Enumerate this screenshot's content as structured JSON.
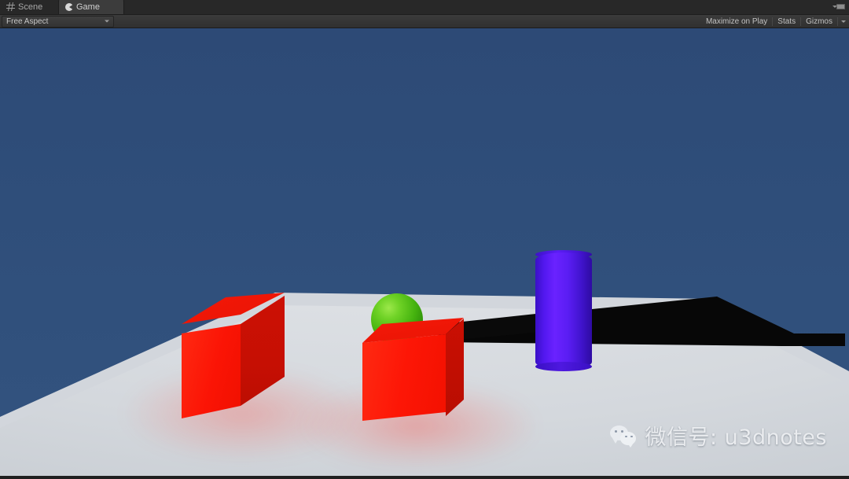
{
  "window": {
    "title": "Unity Game View"
  },
  "tabs": [
    {
      "label": "Scene",
      "icon": "grid-icon",
      "active": false
    },
    {
      "label": "Game",
      "icon": "pacman-icon",
      "active": true
    }
  ],
  "tab_bar": {
    "menu_icon": "panel-menu-icon"
  },
  "toolbar": {
    "aspect": {
      "value": "Free Aspect",
      "caret_icon": "chevron-down-icon"
    },
    "maximize_on_play": "Maximize on Play",
    "stats": "Stats",
    "gizmos": "Gizmos",
    "gizmos_caret_icon": "chevron-down-icon"
  },
  "scene": {
    "background_color": "#2E4C79",
    "ground_color": "#DFE2E6",
    "objects": [
      {
        "name": "cube-left",
        "shape": "cube",
        "color": "#FB1405"
      },
      {
        "name": "cube-center",
        "shape": "cube",
        "color": "#FD1606"
      },
      {
        "name": "sphere-green",
        "shape": "sphere",
        "color": "#52C017"
      },
      {
        "name": "cylinder-purple",
        "shape": "cylinder",
        "color": "#5A1DF3"
      },
      {
        "name": "ground-plane",
        "shape": "plane",
        "color": "#DFE2E6"
      },
      {
        "name": "shadow-band",
        "shape": "shadow",
        "color": "#070707"
      }
    ]
  },
  "watermark": {
    "icon": "wechat-icon",
    "text": "微信号: u3dnotes"
  }
}
